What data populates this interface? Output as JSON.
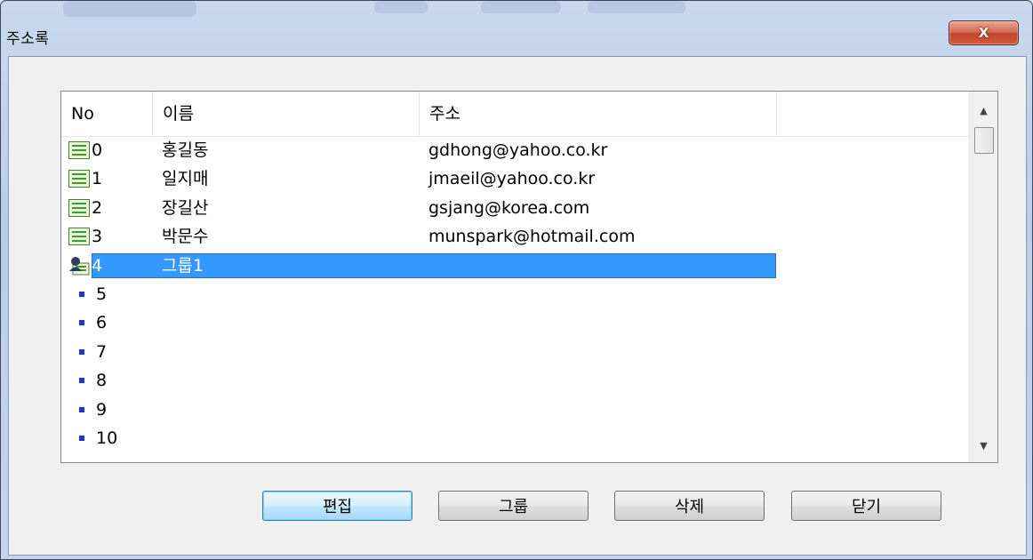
{
  "window": {
    "title": "주소록",
    "close_label": "X"
  },
  "list": {
    "columns": [
      "No",
      "이름",
      "주소",
      ""
    ],
    "rows": [
      {
        "no": "0",
        "name": "홍길동",
        "address": "gdhong@yahoo.co.kr",
        "icon": "contact-card-icon"
      },
      {
        "no": "1",
        "name": "일지매",
        "address": "jmaeil@yahoo.co.kr",
        "icon": "contact-card-icon"
      },
      {
        "no": "2",
        "name": "장길산",
        "address": "gsjang@korea.com",
        "icon": "contact-card-icon"
      },
      {
        "no": "3",
        "name": "박문수",
        "address": "munspark@hotmail.com",
        "icon": "contact-card-icon"
      },
      {
        "no": "4",
        "name": "그룹1",
        "address": "",
        "icon": "group-icon",
        "selected": true
      },
      {
        "no": "5",
        "name": "",
        "address": "",
        "icon": "bullet-icon"
      },
      {
        "no": "6",
        "name": "",
        "address": "",
        "icon": "bullet-icon"
      },
      {
        "no": "7",
        "name": "",
        "address": "",
        "icon": "bullet-icon"
      },
      {
        "no": "8",
        "name": "",
        "address": "",
        "icon": "bullet-icon"
      },
      {
        "no": "9",
        "name": "",
        "address": "",
        "icon": "bullet-icon"
      },
      {
        "no": "10",
        "name": "",
        "address": "",
        "icon": "bullet-icon"
      }
    ]
  },
  "buttons": {
    "edit": "편집",
    "group": "그룹",
    "delete": "삭제",
    "close": "닫기"
  },
  "colors": {
    "selection": "#3399ff",
    "close_button": "#c7472d",
    "bullet": "#2433d6"
  }
}
